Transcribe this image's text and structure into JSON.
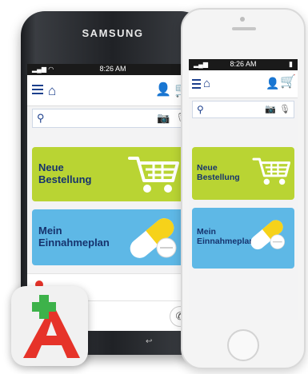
{
  "samsung": {
    "brand": "SAMSUNG",
    "status_time": "8:26 AM",
    "tile_order": {
      "line1": "Neue",
      "line2": "Bestellung"
    },
    "tile_plan": {
      "line1": "Mein",
      "line2": "Einnahmeplan"
    }
  },
  "iphone": {
    "status_time": "8:26 AM",
    "tile_order": {
      "line1": "Neue",
      "line2": "Bestellung"
    },
    "tile_plan": {
      "line1": "Mein",
      "line2": "Einnahmeplan"
    }
  },
  "icons": [
    "menu-icon",
    "home-icon",
    "user-icon",
    "cart-icon",
    "search-icon",
    "camera-icon",
    "microphone-icon",
    "shopping-cart-illustration",
    "pill-illustration",
    "chevron-right-icon",
    "phone-icon",
    "app-logo-icon"
  ],
  "colors": {
    "brand_blue": "#1c3f8c",
    "order_green": "#b9d433",
    "plan_blue": "#5eb8e6",
    "logo_red": "#e63329",
    "logo_green": "#3db24a"
  }
}
